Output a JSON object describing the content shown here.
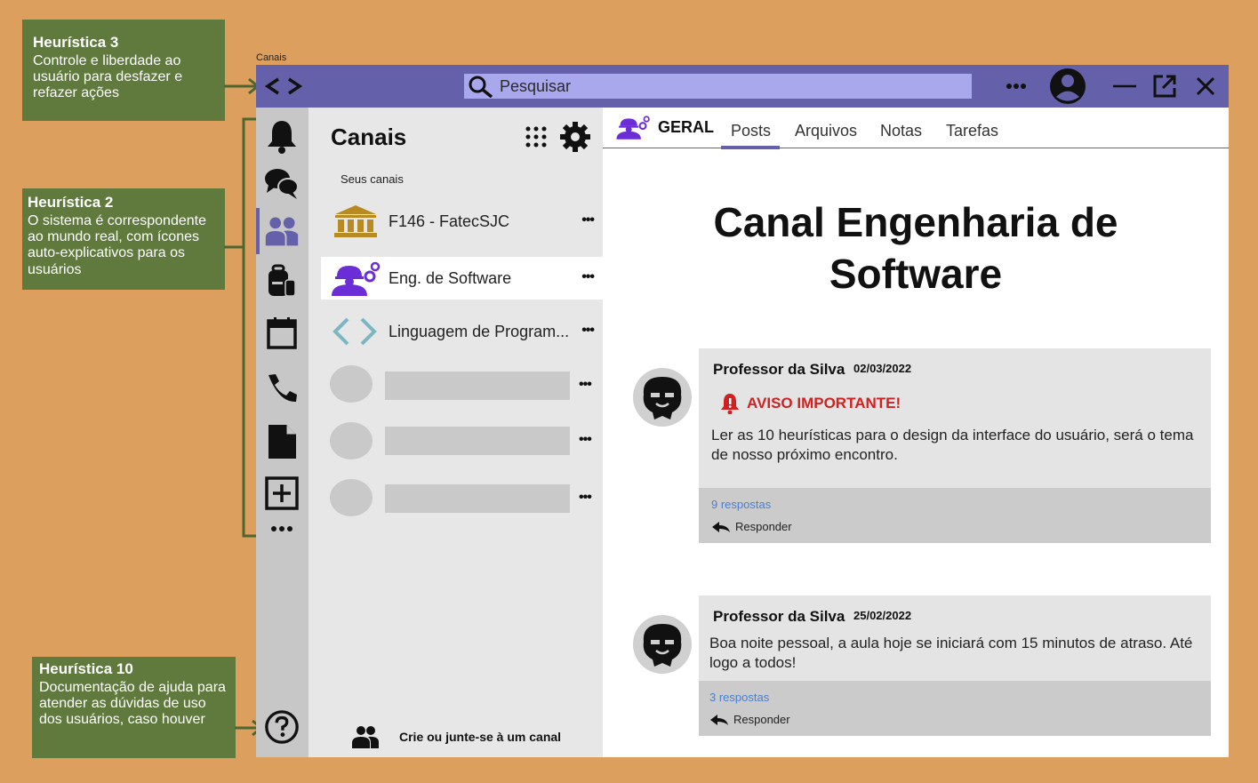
{
  "annotations": {
    "h3": {
      "title": "Heurística 3",
      "text": "Controle e liberdade ao usuário para desfazer e refazer ações"
    },
    "h2": {
      "title": "Heurística 2",
      "text": "O sistema é correspondente ao mundo real, com ícones auto-explicativos para os usuários"
    },
    "h10": {
      "title": "Heurística 10",
      "text": " Documentação de ajuda para atender as dúvidas de uso dos usuários, caso houver"
    }
  },
  "frame_label": "Canais",
  "titlebar": {
    "search_placeholder": "Pesquisar"
  },
  "rail": {
    "icons": [
      "bell-icon",
      "chat-icon",
      "team-icon",
      "backpack-icon",
      "calendar-icon",
      "phone-icon",
      "file-icon",
      "add-icon",
      "more-icon",
      "help-icon"
    ],
    "more_label": "•••"
  },
  "channels": {
    "title": "Canais",
    "section_label": "Seus canais",
    "items": [
      {
        "label": "F146 - FatecSJC",
        "icon": "institution-icon"
      },
      {
        "label": "Eng. de Software",
        "icon": "engineer-icon"
      },
      {
        "label": "Linguagem de Program...",
        "icon": "code-icon"
      }
    ],
    "dots": "•••",
    "create_label": "Crie ou junte-se à um canal"
  },
  "main": {
    "channel_tag": "GERAL",
    "tabs": [
      "Posts",
      "Arquivos",
      "Notas",
      "Tarefas"
    ],
    "active_tab": "Posts",
    "title_line1": "Canal Engenharia de",
    "title_line2": "Software",
    "posts": [
      {
        "author": "Professor da Silva",
        "date": "02/03/2022",
        "alert": "AVISO IMPORTANTE!",
        "body": "Ler as 10 heurísticas para o design da interface do usuário, será o tema de nosso próximo encontro.",
        "replies": "9 respostas",
        "reply_label": "Responder"
      },
      {
        "author": "Professor da Silva",
        "date": "25/02/2022",
        "body": "Boa noite pessoal, a aula hoje se iniciará com 15 minutos de atraso. Até logo a todos!",
        "replies": "3 respostas",
        "reply_label": "Responder"
      }
    ]
  },
  "colors": {
    "background": "#dd9f5e",
    "annotation": "#5f7a3c",
    "accent": "#6461aa",
    "search": "#aaa8ec",
    "alert": "#d02020",
    "link": "#4a7fd1"
  }
}
